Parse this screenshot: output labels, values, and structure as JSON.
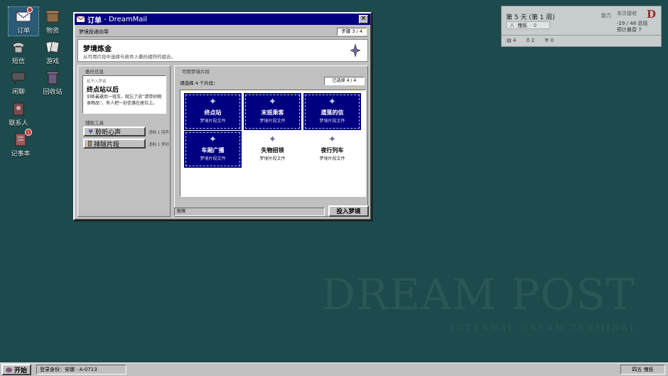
{
  "desktop": {
    "icons": [
      {
        "label": "订单",
        "badge": ""
      },
      {
        "label": "物资",
        "badge": ""
      },
      {
        "label": "短信",
        "badge": ""
      },
      {
        "label": "游戏",
        "badge": ""
      },
      {
        "label": "闲聊",
        "badge": ""
      },
      {
        "label": "回收站",
        "badge": ""
      },
      {
        "label": "联系人",
        "badge": ""
      },
      {
        "label": "记事本",
        "badge": "!"
      }
    ],
    "watermark": {
      "title": "DREAM POST",
      "subtitle": "INTERNAL DREAM TERMINAL"
    }
  },
  "status": {
    "day": "第 5 天 (第 1 周)",
    "mode": "傀铄",
    "mode_tag": "人",
    "mode_extra": "· 0",
    "top_right_label": "本次接收",
    "top_right_label2": "能力",
    "progress": "-29 / 48 总括",
    "progress2": "预计晨昏 7",
    "logo": "D",
    "counts": [
      "4",
      "2",
      "0"
    ]
  },
  "window": {
    "title": "订单",
    "app": "- DreamMail",
    "wizard_label": "梦境投递向导",
    "step": "步骤 3 / 4",
    "heading": "梦境炼金",
    "subheading": "从可用片段中选择与收件人委托相符的组合。",
    "left": {
      "section_title": "委托信息",
      "box_label": "给予入梦者",
      "box_title": "终点站以后",
      "box_text": "训练最避后一班车，就忘了说“请带好随身物品”。有人把一封信落在座位上。",
      "tools_title": "辅助工具",
      "tools": [
        {
          "label": "聆听心声",
          "cost": "消耗 1 回声"
        },
        {
          "label": "排除片段",
          "cost": "消耗 1 梦砂"
        }
      ]
    },
    "right": {
      "section_title": "可用梦境片段",
      "instruction": "请选择 4 个片段：",
      "counter": "已选择 4 / 4",
      "fragments": [
        {
          "name": "终点站",
          "sub": "梦境片段文件",
          "selected": true
        },
        {
          "name": "末班乘客",
          "sub": "梦境片段文件",
          "selected": true
        },
        {
          "name": "遗落的信",
          "sub": "梦境片段文件",
          "selected": true
        },
        {
          "name": "车厢广播",
          "sub": "梦境片段文件",
          "selected": true
        },
        {
          "name": "失物招领",
          "sub": "梦境片段文件",
          "selected": false
        },
        {
          "name": "夜行列车",
          "sub": "梦境片段文件",
          "selected": false
        }
      ]
    },
    "footer_status": "就绪",
    "submit_label": "投入梦境"
  },
  "taskbar": {
    "start_label": "开始",
    "user": "登录身份：安娜 · A-0713",
    "tray": "四五 傀铄"
  },
  "colors": {
    "desktop": "#1d4a4c",
    "titlebar": "#000080",
    "selected_card": "#000080",
    "chrome": "#c0c0c0"
  }
}
